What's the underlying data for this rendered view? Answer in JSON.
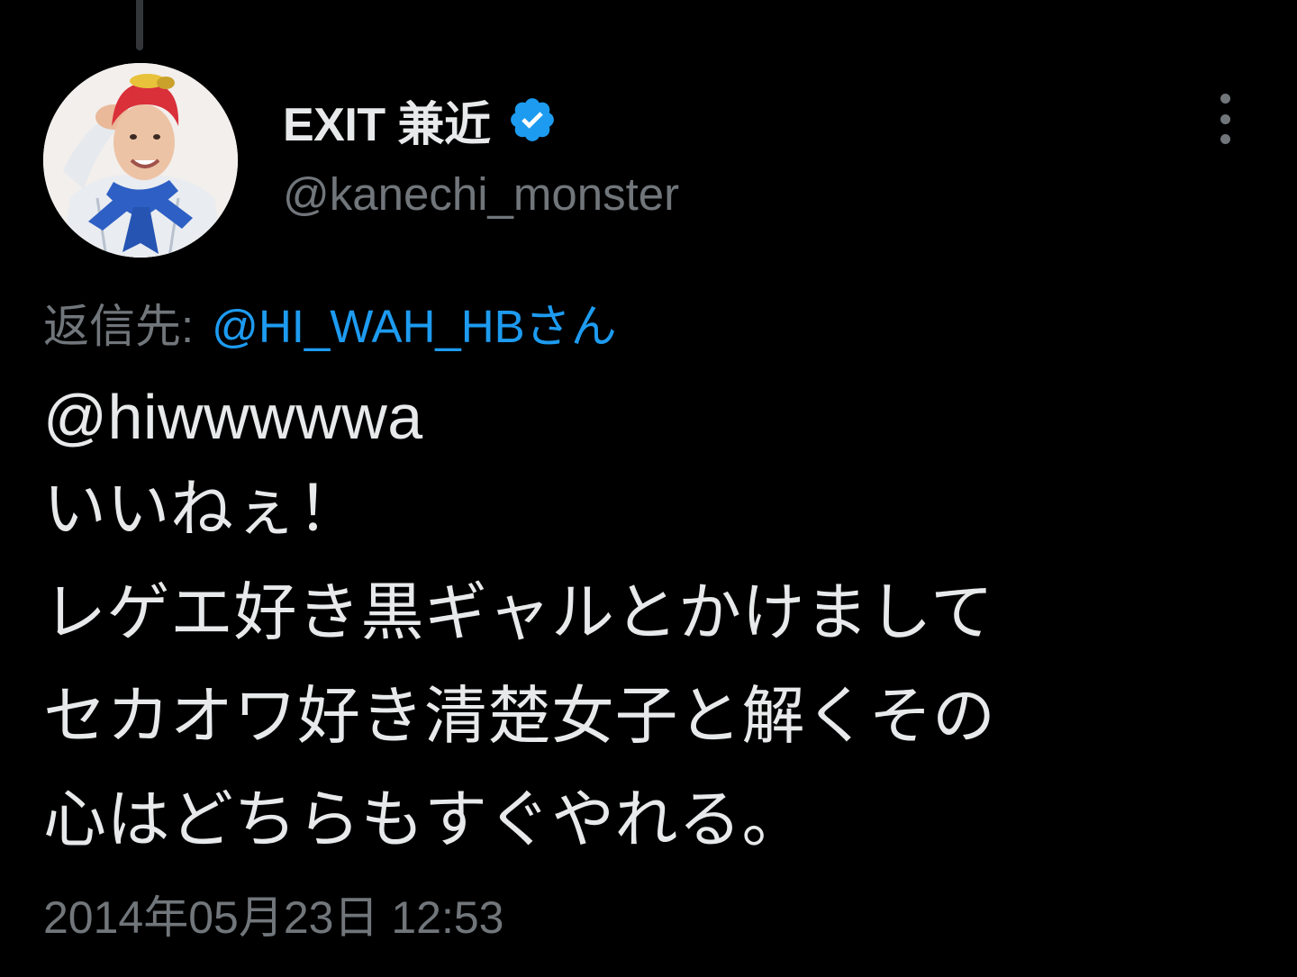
{
  "author": {
    "display_name": "EXIT 兼近",
    "handle": "@kanechi_monster",
    "verified": true,
    "verified_icon": "verified-badge-icon",
    "avatar_icon": "profile-photo"
  },
  "reply": {
    "label": "返信先:",
    "mention": "@HI_WAH_HBさん"
  },
  "tweet": {
    "lines": [
      "@hiwwwwwa",
      "いいねぇ！",
      "レゲエ好き黒ギャルとかけまして",
      "セカオワ好き清楚女子と解くその",
      "心はどちらもすぐやれる。"
    ]
  },
  "timestamp": "2014年05月23日 12:53",
  "colors": {
    "background": "#000000",
    "primary_text": "#e7e9ea",
    "secondary_text": "#71767b",
    "link": "#1d9bf0",
    "verified": "#1d9bf0"
  }
}
